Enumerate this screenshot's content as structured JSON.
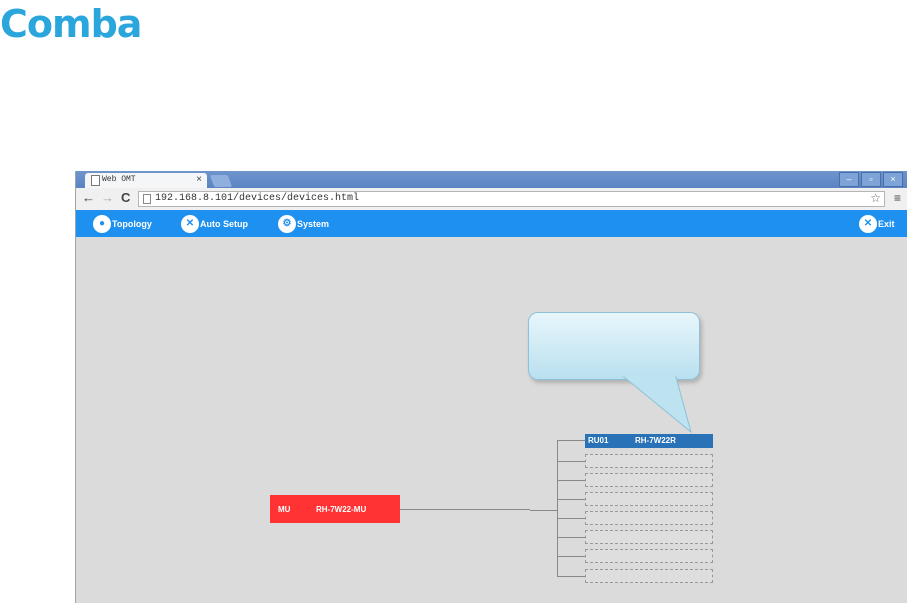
{
  "logo": {
    "text": "Comba"
  },
  "browser": {
    "tab_title": "Web OMT",
    "tab_close": "×",
    "url": "192.168.8.101/devices/devices.html",
    "nav_back": "←",
    "nav_forward": "→",
    "nav_reload": "C",
    "bookmark_star": "☆",
    "menu": "≡",
    "win_min": "–",
    "win_max": "▫",
    "win_close": "×"
  },
  "appnav": {
    "items": [
      {
        "label": "Topology",
        "icon": "topology-icon"
      },
      {
        "label": "Auto Setup",
        "icon": "auto-setup-icon"
      },
      {
        "label": "System",
        "icon": "system-gear-icon"
      }
    ],
    "exit_label": "Exit"
  },
  "topology": {
    "mu": {
      "name": "MU",
      "model": "RH-7W22-MU"
    },
    "ru": {
      "name": "RU01",
      "model": "RH-7W22R"
    },
    "colors": {
      "mu": "#ff3333",
      "ru": "#2a72b8",
      "nav": "#1e90f0"
    }
  }
}
